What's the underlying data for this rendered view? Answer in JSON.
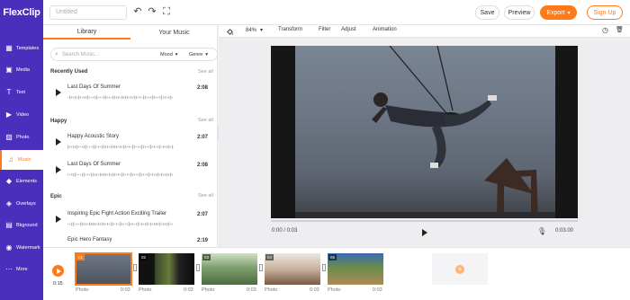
{
  "app": {
    "logo": "FlexClip"
  },
  "topbar": {
    "title_placeholder": "Untitled",
    "save_label": "Save",
    "preview_label": "Preview",
    "export_label": "Export",
    "export_arrow": "▾",
    "signup_label": "Sign Up",
    "undo_icon": "↶",
    "redo_icon": "↷",
    "fullscreen_icon": "⛶"
  },
  "sidebar": {
    "items": [
      {
        "label": "Templates",
        "icon": "▦"
      },
      {
        "label": "Media",
        "icon": "▣"
      },
      {
        "label": "Text",
        "icon": "T"
      },
      {
        "label": "Video",
        "icon": "▶"
      },
      {
        "label": "Photo",
        "icon": "▨"
      },
      {
        "label": "Music",
        "icon": "♫"
      },
      {
        "label": "Elements",
        "icon": "◆"
      },
      {
        "label": "Overlays",
        "icon": "◈"
      },
      {
        "label": "Bkground",
        "icon": "▤"
      },
      {
        "label": "Watermark",
        "icon": "◉"
      },
      {
        "label": "More",
        "icon": "⋯"
      }
    ],
    "active_index": 5
  },
  "music_panel": {
    "tabs": [
      "Library",
      "Your Music"
    ],
    "active_tab": 0,
    "search_placeholder": "Search Music...",
    "search_icon": "⌕",
    "filters": [
      {
        "label": "Mood",
        "chevron": "▾"
      },
      {
        "label": "Genre",
        "chevron": "▾"
      }
    ],
    "see_all": "See all",
    "sections": [
      {
        "title": "Recently Used",
        "tracks": [
          {
            "name": "Last Days Of Summer",
            "duration": "2:08"
          }
        ]
      },
      {
        "title": "Happy",
        "tracks": [
          {
            "name": "Happy Acoustic Story",
            "duration": "2:07"
          },
          {
            "name": "Last Days Of Summer",
            "duration": "2:08"
          }
        ]
      },
      {
        "title": "Epic",
        "tracks": [
          {
            "name": "Inspiring Epic Fight Action Exciting Trailer",
            "duration": "2:07"
          },
          {
            "name": "Epic Hero Fantasy",
            "duration": "2:19"
          }
        ]
      }
    ],
    "collapse_icon": "‹"
  },
  "toolbar": {
    "zoom": "84%",
    "zoom_chevron": "▾",
    "items": [
      "Transform",
      "Filter",
      "Adjust",
      "Animation"
    ],
    "history_icon": "◷",
    "delete_icon": "🗑"
  },
  "player": {
    "current_time": "0:00 / 0:03",
    "end_time": "0:03.00",
    "mic_icon": "🎙"
  },
  "timeline": {
    "time": "0:15",
    "add_icon": "+",
    "clips": [
      {
        "badge": "01",
        "label": "Photo",
        "duration": "0:03",
        "selected": true
      },
      {
        "badge": "02",
        "label": "Photo",
        "duration": "0:03",
        "selected": false
      },
      {
        "badge": "03",
        "label": "Photo",
        "duration": "0:03",
        "selected": false
      },
      {
        "badge": "04",
        "label": "Photo",
        "duration": "0:03",
        "selected": false
      },
      {
        "badge": "05",
        "label": "Photo",
        "duration": "0:03",
        "selected": false
      }
    ]
  },
  "colors": {
    "brand": "#4a2fbd",
    "accent": "#ff7a1a"
  }
}
